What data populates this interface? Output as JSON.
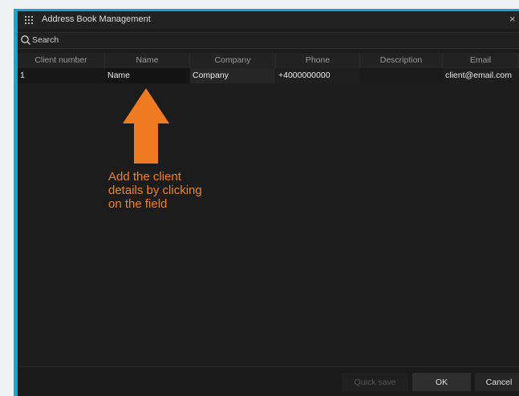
{
  "window": {
    "title": "Address Book Management",
    "close_glyph": "×"
  },
  "search": {
    "placeholder": "Search"
  },
  "table": {
    "columns": [
      "Client number",
      "Name",
      "Company",
      "Phone",
      "Description",
      "Email"
    ],
    "rows": [
      {
        "client_number": "1",
        "name": "Name",
        "company": "Company",
        "phone": "+4000000000",
        "description": "",
        "email": "client@email.com"
      }
    ]
  },
  "annotation": {
    "lines": [
      "Add the client",
      "details by clicking",
      "on the field"
    ],
    "color": "#f08020"
  },
  "footer": {
    "quick_save": "Quick save",
    "ok": "OK",
    "cancel": "Cancel"
  },
  "colors": {
    "frame": "#19a3d6",
    "background": "#1c1c1c"
  }
}
